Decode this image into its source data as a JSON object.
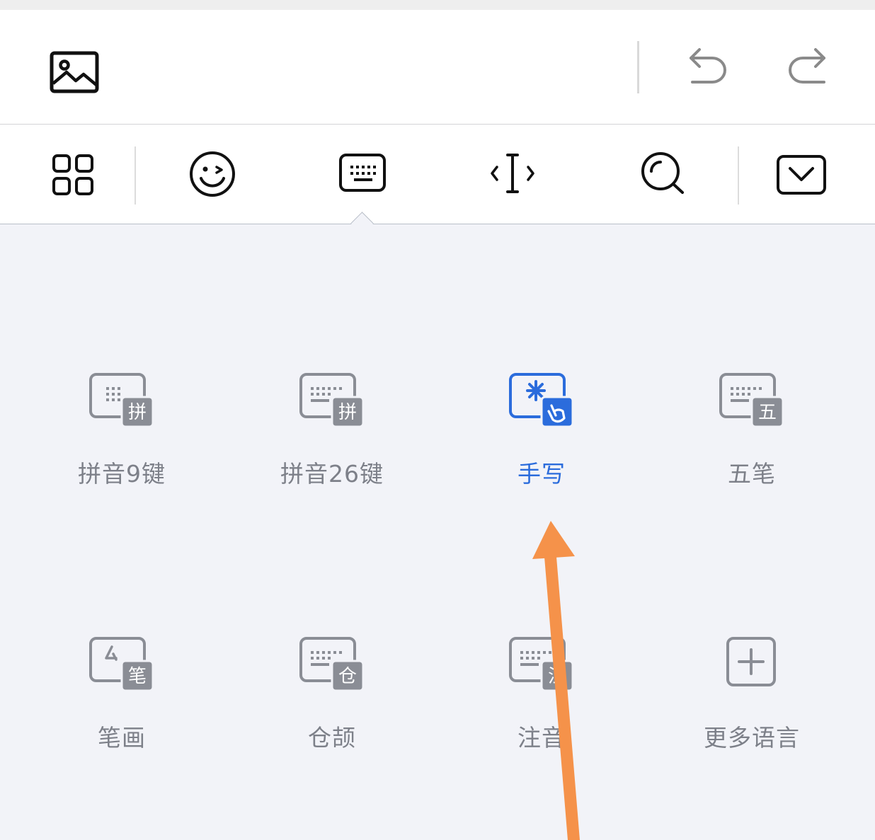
{
  "colors": {
    "accent": "#2b6cdc",
    "label_gray": "#7d8089",
    "icon_gray": "#8a8d95",
    "panel_bg": "#f2f3f8",
    "annotation_arrow": "#f5924a"
  },
  "top_toolbar": {
    "image_icon": "image-icon",
    "undo_icon": "undo-icon",
    "redo_icon": "redo-icon"
  },
  "keyboard_toolbar": {
    "items": [
      "apps-grid-icon",
      "emoji-icon",
      "keyboard-icon",
      "cursor-move-icon",
      "search-icon",
      "collapse-keyboard-icon"
    ],
    "active": "keyboard-icon"
  },
  "layouts": [
    {
      "label": "拼音9键",
      "badge": "拼",
      "icon": "pinyin-9-key-icon"
    },
    {
      "label": "拼音26键",
      "badge": "拼",
      "icon": "pinyin-26-key-icon"
    },
    {
      "label": "手写",
      "badge": "",
      "icon": "handwriting-icon",
      "selected": true
    },
    {
      "label": "五笔",
      "badge": "五",
      "icon": "wubi-icon"
    },
    {
      "label": "笔画",
      "badge": "笔",
      "icon": "stroke-icon"
    },
    {
      "label": "仓颉",
      "badge": "仓",
      "icon": "cangjie-icon"
    },
    {
      "label": "注音",
      "badge": "注",
      "icon": "zhuyin-icon"
    },
    {
      "label": "更多语言",
      "badge": "",
      "icon": "more-languages-icon"
    }
  ]
}
